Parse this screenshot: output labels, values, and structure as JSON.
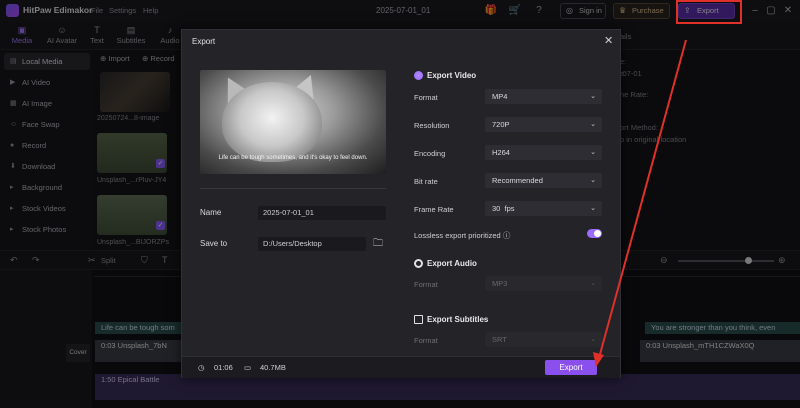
{
  "app": {
    "brand": "HitPaw Edimakor",
    "menu": [
      "File",
      "Settings",
      "Help"
    ],
    "doc_title": "2025-07-01_01",
    "sign_in": "Sign in",
    "purchase": "Purchase",
    "export": "Export"
  },
  "tabs": [
    {
      "label": "Media",
      "icon": "media-icon"
    },
    {
      "label": "AI Avatar",
      "icon": "avatar-icon"
    },
    {
      "label": "Text",
      "icon": "text-icon"
    },
    {
      "label": "Subtitles",
      "icon": "subtitles-icon"
    },
    {
      "label": "Audio",
      "icon": "audio-icon"
    }
  ],
  "left_nav": [
    "Local Media",
    "AI Video",
    "AI Image",
    "Face Swap",
    "Record",
    "Download",
    "Background",
    "Stock Videos",
    "Stock Photos"
  ],
  "media": {
    "import": "Import",
    "record": "Record",
    "items": [
      "20250724...8-image",
      "Unsplash_...rPluv-JY4",
      "Unsplash_...BIJORZPs"
    ]
  },
  "right_panel": {
    "tab": "ails",
    "lines": [
      "e:",
      "e:",
      "-07-01",
      "ne Rate:",
      "ort Method:",
      "p in original location"
    ]
  },
  "toolbar": {
    "split": "Split"
  },
  "timeline": {
    "cover": "Cover",
    "text_clip_1": "Life can be tough som",
    "text_clip_2": "You are stronger than you think, even",
    "video_clip_1": "0:03 Unsplash_7bN",
    "video_clip_2": "0:03 Unsplash_mTH1CZWaX0Q",
    "audio_clip": "1:50 Epical Battle"
  },
  "dialog": {
    "title": "Export",
    "preview_subtitle": "Life can be tough sometimes, and it's okay to feel down.",
    "name_label": "Name",
    "name_value": "2025-07-01_01",
    "save_label": "Save to",
    "save_value": "D:/Users/Desktop",
    "export_video": "Export Video",
    "format_label": "Format",
    "format_value": "MP4",
    "resolution_label": "Resolution",
    "resolution_value": "720P",
    "encoding_label": "Encoding",
    "encoding_value": "H264",
    "bitrate_label": "Bit rate",
    "bitrate_value": "Recommended",
    "framerate_label": "Frame Rate",
    "framerate_value": "30  fps",
    "lossless_label": "Lossless export prioritized",
    "export_audio": "Export Audio",
    "audio_format_label": "Format",
    "audio_format_value": "MP3",
    "export_subtitles": "Export Subtitles",
    "sub_format_label": "Format",
    "sub_format_value": "SRT",
    "duration": "01:06",
    "size": "40.7MB",
    "export_button": "Export"
  },
  "colors": {
    "accent": "#8a50ee",
    "annotation_red": "#e0302a"
  }
}
